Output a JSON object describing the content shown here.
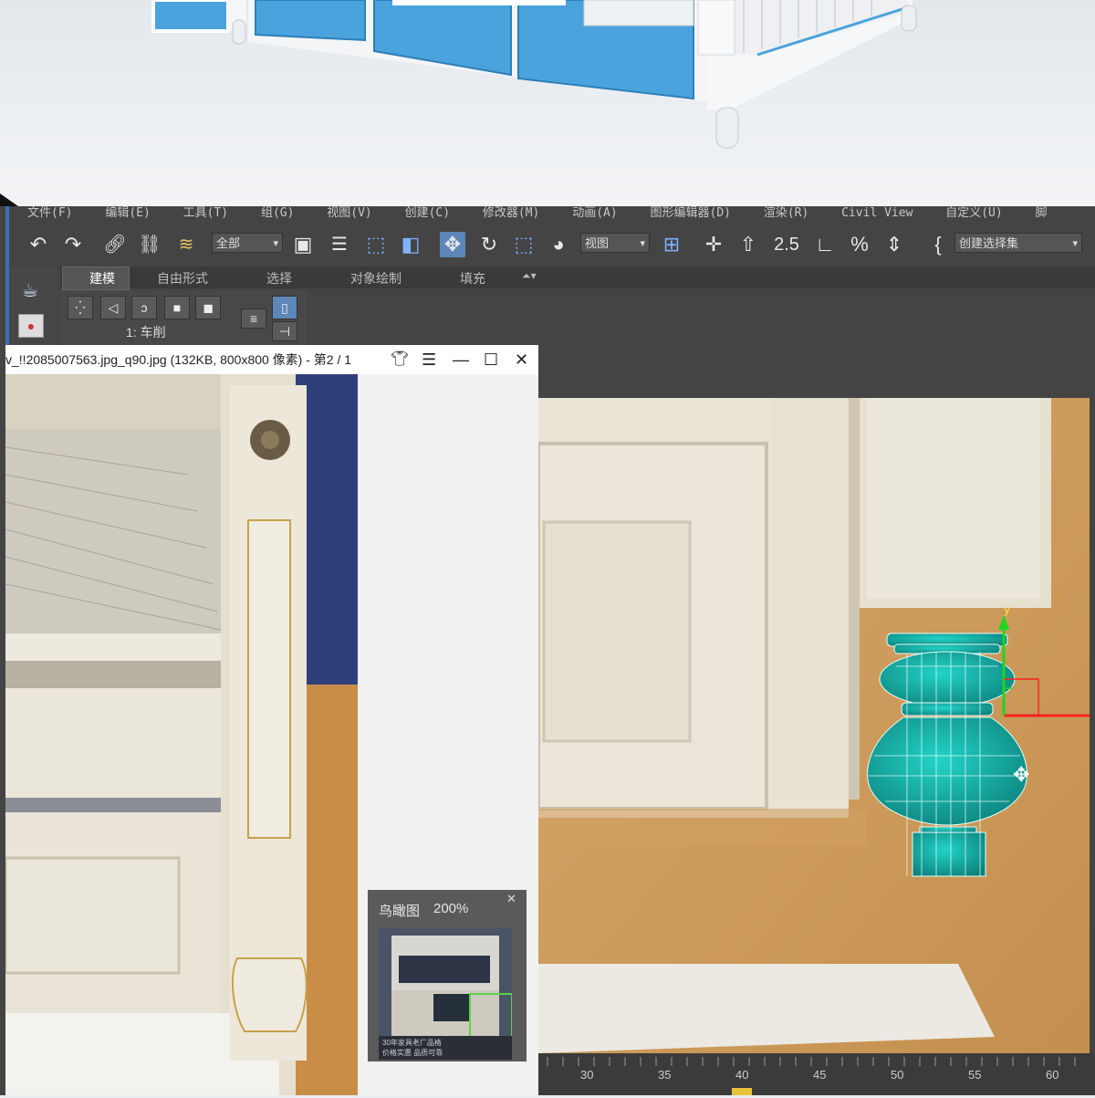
{
  "menu": [
    "文件(F)",
    "编辑(E)",
    "工具(T)",
    "组(G)",
    "视图(V)",
    "创建(C)",
    "修改器(M)",
    "动画(A)",
    "图形编辑器(D)",
    "渲染(R)",
    "Civil View",
    "自定义(U)",
    "脚"
  ],
  "toolbar": {
    "selection_filter": "全部",
    "ref_coord": "视图",
    "snap_label": "2.5",
    "named_selection": "创建选择集"
  },
  "ribbon": {
    "tabs": [
      "建模",
      "自由形式",
      "选择",
      "对象绘制",
      "填充"
    ],
    "active_tab": "建模",
    "panel_label": "1: 车削"
  },
  "viewer": {
    "title": "v_!!2085007563.jpg_q90.jpg (132KB, 800x800 像素) - 第2 / 1",
    "birdseye_label": "鸟瞰图",
    "birdseye_zoom": "200%",
    "thumb_caption_1": "30年家具老厂品格",
    "thumb_caption_2": "价格实惠 品质可靠"
  },
  "viewport": {
    "gizmo_axis_y": "y"
  },
  "timeline": {
    "ticks": [
      "30",
      "35",
      "40",
      "45",
      "50",
      "55",
      "60"
    ]
  },
  "colors": {
    "max_bg": "#444444",
    "active_tool": "#5d87b8",
    "model": "#1aa39a",
    "cabinet_blue": "#4aa3dc"
  }
}
